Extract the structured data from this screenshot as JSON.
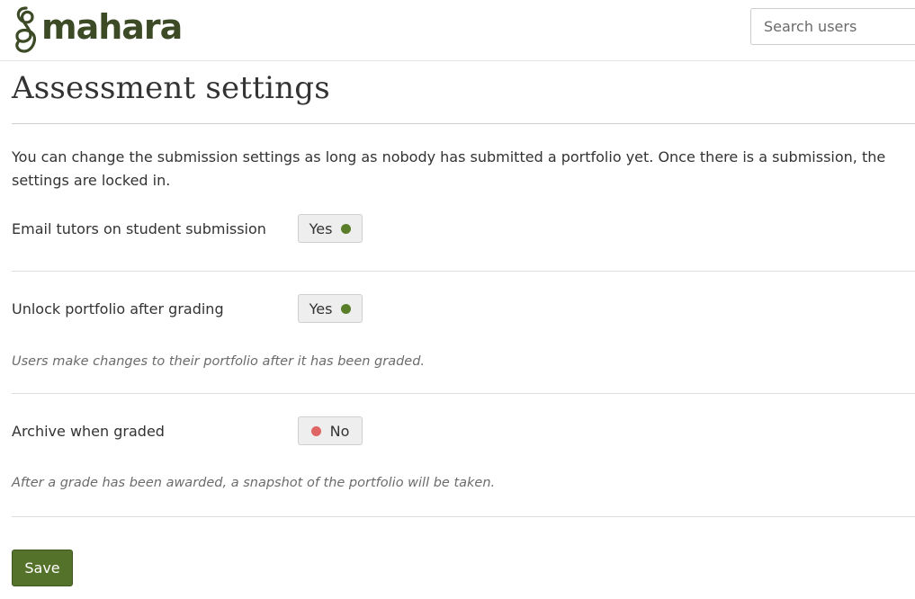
{
  "header": {
    "logo_text": "mahara",
    "search_placeholder": "Search users"
  },
  "page": {
    "title": "Assessment settings",
    "intro": "You can change the submission settings as long as nobody has submitted a portfolio yet. Once there is a submission, the settings are locked in."
  },
  "settings": [
    {
      "label": "Email tutors on student submission",
      "value": "Yes",
      "state": "on",
      "help": ""
    },
    {
      "label": "Unlock portfolio after grading",
      "value": "Yes",
      "state": "on",
      "help": "Users make changes to their portfolio after it has been graded."
    },
    {
      "label": "Archive when graded",
      "value": "No",
      "state": "off",
      "help": "After a grade has been awarded, a snapshot of the portfolio will be taken."
    }
  ],
  "actions": {
    "save_label": "Save"
  },
  "colors": {
    "brand": "#3d4a26",
    "toggle_on": "#5a7d2a",
    "toggle_off": "#e06666",
    "save_button": "#55722b"
  }
}
